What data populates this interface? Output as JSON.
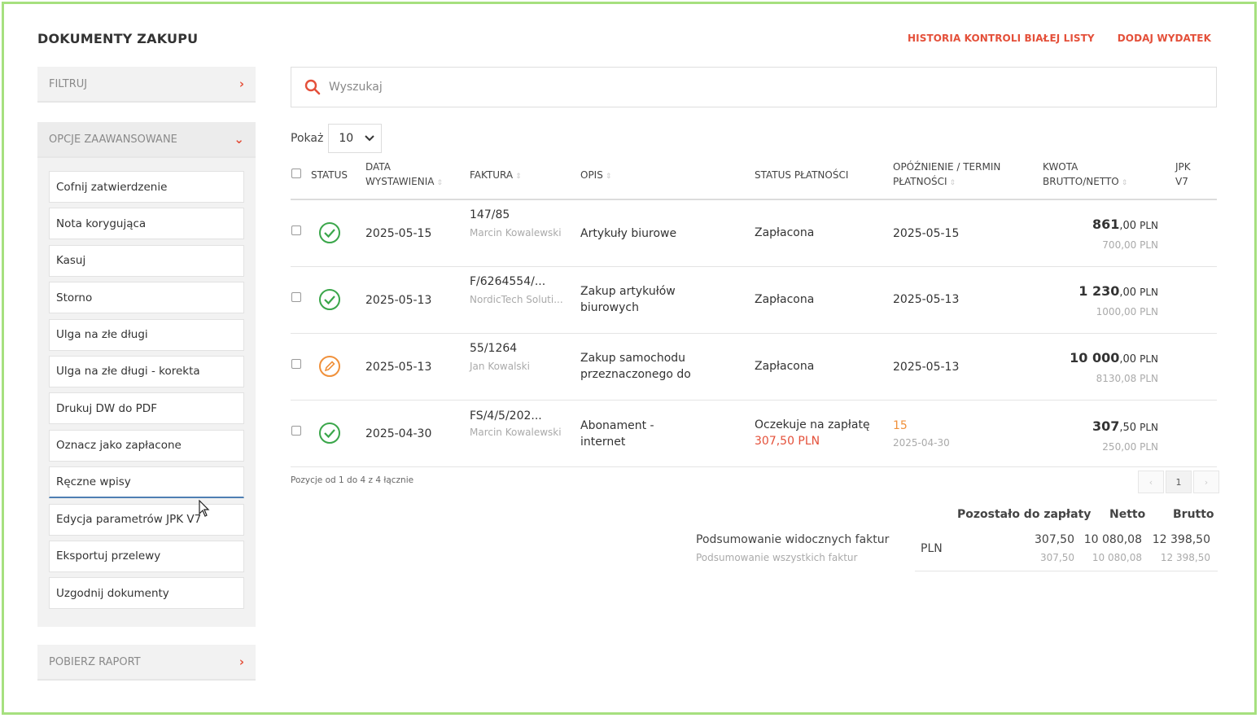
{
  "header": {
    "title": "DOKUMENTY ZAKUPU",
    "links": [
      "HISTORIA KONTROLI BIAŁEJ LISTY",
      "DODAJ WYDATEK"
    ]
  },
  "sidebar": {
    "filter_label": "FILTRUJ",
    "advanced_label": "OPCJE ZAAWANSOWANE",
    "advanced_items": [
      "Cofnij zatwierdzenie",
      "Nota korygująca",
      "Kasuj",
      "Storno",
      "Ulga na złe długi",
      "Ulga na złe długi - korekta",
      "Drukuj DW do PDF",
      "Oznacz jako zapłacone",
      "Ręczne wpisy",
      "Edycja parametrów JPK V7",
      "Eksportuj przelewy",
      "Uzgodnij dokumenty"
    ],
    "report_label": "POBIERZ RAPORT"
  },
  "search": {
    "placeholder": "Wyszukaj"
  },
  "show": {
    "label": "Pokaż",
    "value": "10"
  },
  "table": {
    "headers": {
      "status": "STATUS",
      "date_1": "DATA",
      "date_2": "WYSTAWIENIA",
      "invoice": "FAKTURA",
      "desc": "OPIS",
      "payment_status": "STATUS PŁATNOŚCI",
      "delay_1": "OPÓŹNIENIE / TERMIN",
      "delay_2": "PŁATNOŚCI",
      "amount_1": "KWOTA",
      "amount_2": "BRUTTO/NETTO",
      "jpk_1": "JPK",
      "jpk_2": "V7"
    },
    "rows": [
      {
        "status_icon": "check-circle-icon",
        "date": "2025-05-15",
        "invoice_no": "147/85",
        "invoice_party": "Marcin Kowalewski",
        "desc_1": "Artykuły biurowe",
        "desc_2": "",
        "payment_status": "Zapłacona",
        "payment_amount": "",
        "delay": "",
        "due_date": "2025-05-15",
        "gross_int": "861",
        "gross_dec": ",00",
        "currency": "PLN",
        "net": "700,00 PLN"
      },
      {
        "status_icon": "check-circle-icon",
        "date": "2025-05-13",
        "invoice_no": "F/6264554/...",
        "invoice_party": "NordicTech Soluti...",
        "desc_1": "Zakup artykułów",
        "desc_2": "biurowych",
        "payment_status": "Zapłacona",
        "payment_amount": "",
        "delay": "",
        "due_date": "2025-05-13",
        "gross_int": "1 230",
        "gross_dec": ",00",
        "currency": "PLN",
        "net": "1000,00 PLN"
      },
      {
        "status_icon": "pencil-circle-icon",
        "date": "2025-05-13",
        "invoice_no": "55/1264",
        "invoice_party": "Jan Kowalski",
        "desc_1": "Zakup samochodu",
        "desc_2": "przeznaczonego do",
        "payment_status": "Zapłacona",
        "payment_amount": "",
        "delay": "",
        "due_date": "2025-05-13",
        "gross_int": "10 000",
        "gross_dec": ",00",
        "currency": "PLN",
        "net": "8130,08 PLN"
      },
      {
        "status_icon": "check-circle-icon",
        "date": "2025-04-30",
        "invoice_no": "FS/4/5/202...",
        "invoice_party": "Marcin Kowalewski",
        "desc_1": "Abonament -",
        "desc_2": "internet",
        "payment_status": "Oczekuje na zapłatę",
        "payment_amount": "307,50 PLN",
        "delay": "15",
        "due_date": "2025-04-30",
        "gross_int": "307",
        "gross_dec": ",50",
        "currency": "PLN",
        "net": "250,00 PLN"
      }
    ]
  },
  "pagination": {
    "info": "Pozycje od 1 do 4 z 4 łącznie",
    "prev": "‹",
    "page": "1",
    "next": "›"
  },
  "summary": {
    "col_remaining": "Pozostało do zapłaty",
    "col_net": "Netto",
    "col_gross": "Brutto",
    "visible_label": "Podsumowanie widocznych faktur",
    "all_label": "Podsumowanie wszystkich faktur",
    "currency": "PLN",
    "visible": {
      "remaining": "307,50",
      "net": "10 080,08",
      "gross": "12 398,50"
    },
    "all": {
      "remaining": "307,50",
      "net": "10 080,08",
      "gross": "12 398,50"
    }
  },
  "colors": {
    "accent": "#e4503a",
    "success": "#3aa64a",
    "warning": "#f0903a",
    "frame": "#a6e07f"
  }
}
